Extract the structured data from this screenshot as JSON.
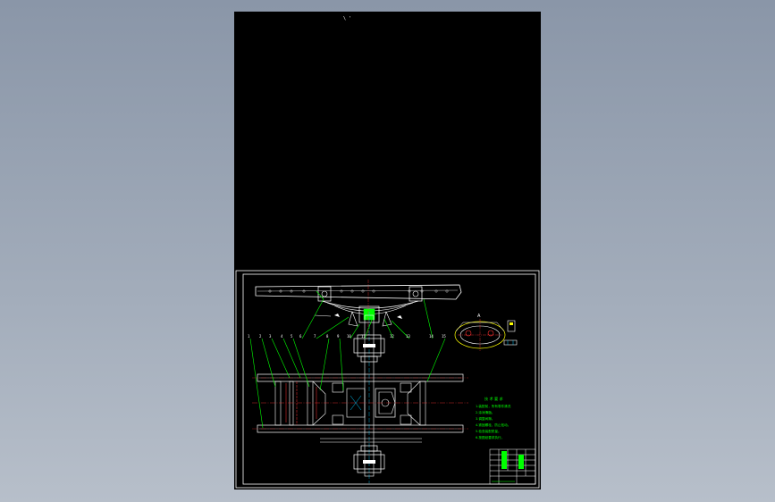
{
  "drawing": {
    "top_mark": "\\ '",
    "notes_title": "技 术 要 求",
    "notes": [
      "1.装配前，所有零件清洗",
      "2.涂润滑脂。",
      "3.调整间隙。",
      "4.紧固螺栓，防止松动。",
      "5.检查装配质量。",
      "6.按图纸要求执行。"
    ],
    "balloons": [
      "1",
      "2",
      "3",
      "4",
      "5",
      "6",
      "7",
      "8",
      "9",
      "10",
      "11",
      "12",
      "13",
      "14",
      "15"
    ],
    "detail_label": "A",
    "title_block": {
      "cells": [
        "",
        "",
        "",
        ""
      ]
    },
    "colors": {
      "sheet": "#000000",
      "linework": "#ffffff",
      "leaders": "#00ff00",
      "centerlines": "#ff3030",
      "hidden": "#00c8ff",
      "accent": "#ffff00"
    }
  }
}
